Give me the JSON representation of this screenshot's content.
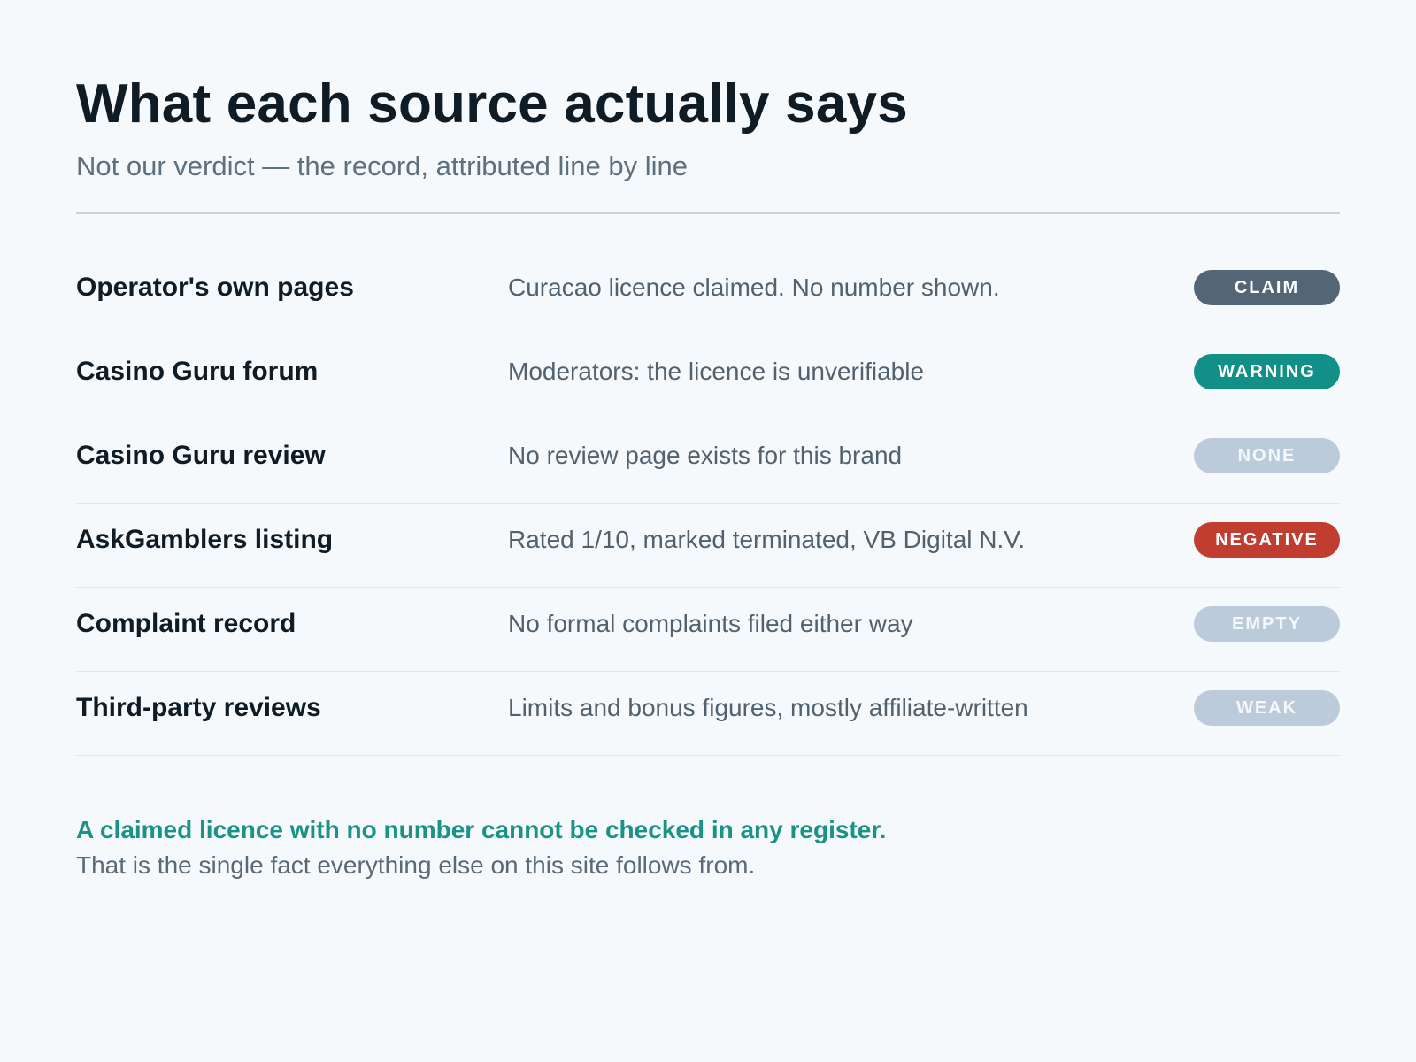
{
  "header": {
    "title": "What each source actually says",
    "subtitle": "Not our verdict — the record, attributed line by line"
  },
  "rows": [
    {
      "source": "Operator's own pages",
      "statement": "Curacao licence claimed. No number shown.",
      "badge": "CLAIM",
      "badge_color": "#546576",
      "badge_text_color": "#ffffff"
    },
    {
      "source": "Casino Guru forum",
      "statement": "Moderators: the licence is unverifiable",
      "badge": "WARNING",
      "badge_color": "#128f86",
      "badge_text_color": "#ffffff"
    },
    {
      "source": "Casino Guru review",
      "statement": "No review page exists for this brand",
      "badge": "NONE",
      "badge_color": "#bccbda",
      "badge_text_color": "#f4f8fb"
    },
    {
      "source": "AskGamblers listing",
      "statement": "Rated 1/10, marked terminated, VB Digital N.V.",
      "badge": "NEGATIVE",
      "badge_color": "#c13d2f",
      "badge_text_color": "#ffffff"
    },
    {
      "source": "Complaint record",
      "statement": "No formal complaints filed either way",
      "badge": "EMPTY",
      "badge_color": "#bccbda",
      "badge_text_color": "#f4f8fb"
    },
    {
      "source": "Third-party reviews",
      "statement": "Limits and bonus figures, mostly affiliate-written",
      "badge": "WEAK",
      "badge_color": "#bccbda",
      "badge_text_color": "#f4f8fb"
    }
  ],
  "callout": {
    "lead": "A claimed licence with no number cannot be checked in any register.",
    "body": "That is the single fact everything else on this site follows from.",
    "accent_color": "#1a9286"
  }
}
